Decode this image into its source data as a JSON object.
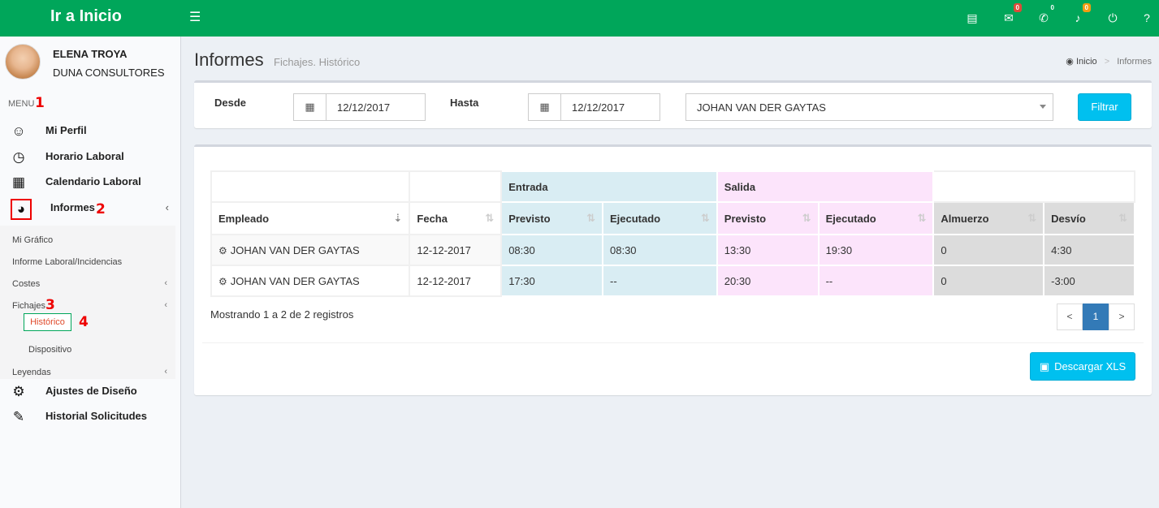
{
  "topbar": {
    "brand": "Ir a Inicio",
    "icons": [
      {
        "name": "newspaper-icon",
        "glyph": "▤",
        "badge": ""
      },
      {
        "name": "comments-icon",
        "glyph": "✉",
        "badge": "0",
        "badge_color": "#dd4b39"
      },
      {
        "name": "phone-icon",
        "glyph": "✆",
        "badge": "0",
        "badge_color": "#00a65a"
      },
      {
        "name": "bell-icon",
        "glyph": "♪",
        "badge": "0",
        "badge_color": "#f39c12"
      },
      {
        "name": "power-icon",
        "glyph": "⏻",
        "badge": ""
      },
      {
        "name": "help-icon",
        "glyph": "?",
        "badge": ""
      }
    ]
  },
  "user": {
    "name": "ELENA TROYA",
    "company": "DUNA CONSULTORES"
  },
  "sidebar": {
    "header": "MENU",
    "markers": {
      "m1": "1",
      "m2": "2",
      "m3": "3",
      "m4": "4"
    },
    "items": [
      {
        "label": "Mi Perfil",
        "icon": "smile-icon"
      },
      {
        "label": "Horario Laboral",
        "icon": "clock-icon"
      },
      {
        "label": "Calendario Laboral",
        "icon": "calendar-icon"
      },
      {
        "label": "Informes",
        "icon": "pie-chart-icon"
      },
      {
        "label": "Ajustes de Diseño",
        "icon": "gear-icon"
      },
      {
        "label": "Historial Solicitudes",
        "icon": "edit-icon"
      }
    ],
    "submenu": {
      "mi_grafico": "Mi Gráfico",
      "informe_laboral": "Informe Laboral/Incidencias",
      "costes": "Costes",
      "fichajes": "Fichajes",
      "historico": "Histórico",
      "dispositivo": "Dispositivo",
      "leyendas": "Leyendas"
    }
  },
  "header": {
    "title": "Informes",
    "subtitle": "Fichajes. Histórico",
    "breadcrumb": {
      "home": "Inicio",
      "current": "Informes"
    }
  },
  "filter": {
    "desde_label": "Desde",
    "desde_value": "12/12/2017",
    "hasta_label": "Hasta",
    "hasta_value": "12/12/2017",
    "employee_selected": "JOHAN VAN DER GAYTAS",
    "filter_button": "Filtrar"
  },
  "table": {
    "groups": {
      "entrada": "Entrada",
      "salida": "Salida"
    },
    "columns": [
      "Empleado",
      "Fecha",
      "Previsto",
      "Ejecutado",
      "Previsto",
      "Ejecutado",
      "Almuerzo",
      "Desvío"
    ],
    "rows": [
      [
        "JOHAN VAN DER GAYTAS",
        "12-12-2017",
        "08:30",
        "08:30",
        "13:30",
        "19:30",
        "0",
        "4:30"
      ],
      [
        "JOHAN VAN DER GAYTAS",
        "12-12-2017",
        "17:30",
        "--",
        "20:30",
        "--",
        "0",
        "-3:00"
      ]
    ],
    "info": "Mostrando 1 a 2 de 2 registros",
    "pagination": {
      "prev": "<",
      "current": "1",
      "next": ">"
    },
    "download_button": "Descargar XLS"
  },
  "colors": {
    "brand": "#00a65a",
    "info_button": "#00c0ef",
    "entrada_bg": "#d9edf3",
    "salida_bg": "#fce4fb",
    "gray_bg": "#dcdcdc"
  }
}
